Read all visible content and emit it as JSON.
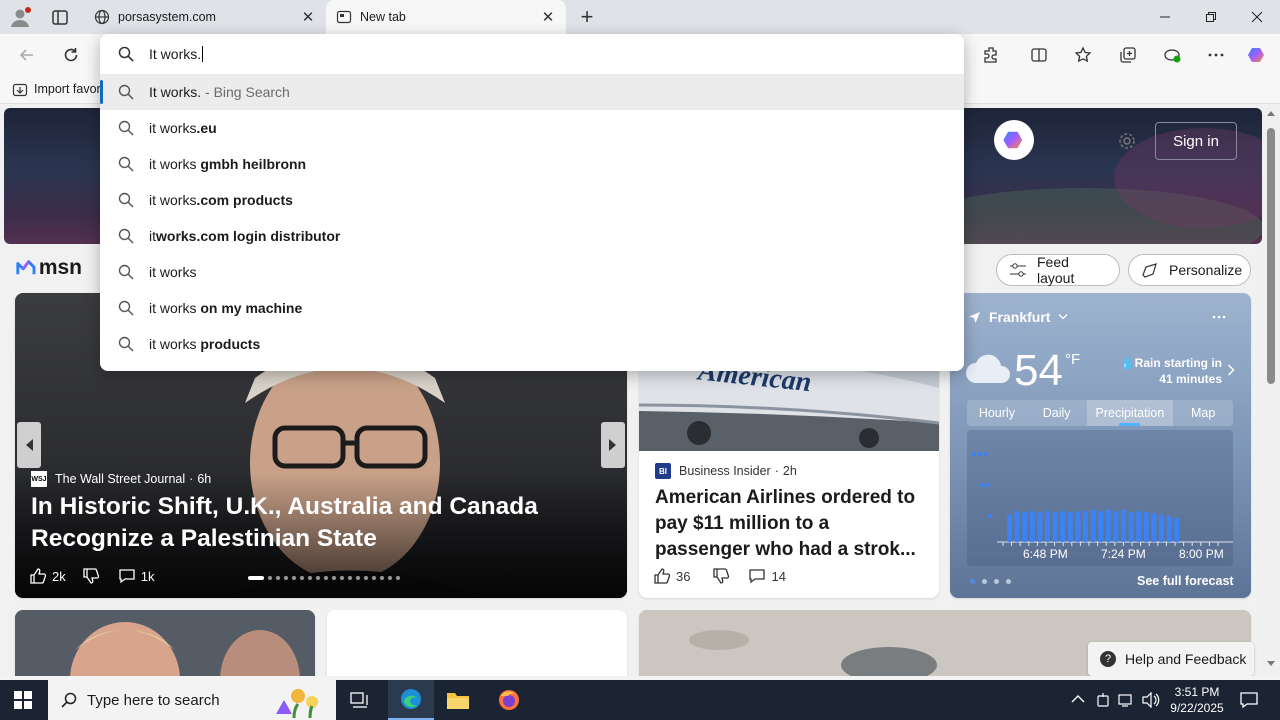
{
  "browser": {
    "tabs": [
      {
        "title": "porsasystem.com",
        "icon": "globe-icon"
      },
      {
        "title": "New tab",
        "icon": "newtab-icon"
      }
    ],
    "favorites_bar": {
      "import_label": "Import favor"
    }
  },
  "omnibox": {
    "query": "It works.",
    "suggestions": [
      {
        "prefix": "It works.",
        "bold": "",
        "suffix": " - Bing Search"
      },
      {
        "prefix": "it works",
        "bold": ".eu",
        "suffix": ""
      },
      {
        "prefix": "it works ",
        "bold": "gmbh heilbronn",
        "suffix": ""
      },
      {
        "prefix": "it works",
        "bold": ".com products",
        "suffix": ""
      },
      {
        "prefix": "it",
        "bold": "works.com login distributor",
        "suffix": ""
      },
      {
        "prefix": "it works",
        "bold": "",
        "suffix": ""
      },
      {
        "prefix": "it works ",
        "bold": "on my machine",
        "suffix": ""
      },
      {
        "prefix": "it works ",
        "bold": "products",
        "suffix": ""
      }
    ]
  },
  "msn": {
    "logo_text": "msn",
    "sign_in": "Sign in",
    "feed_layout": "Feed layout",
    "personalize": "Personalize",
    "main_story": {
      "source": "The Wall Street Journal",
      "source_badge": "WSJ",
      "age": "6h",
      "headline": "In Historic Shift, U.K., Australia and Canada Recognize a Palestinian State",
      "likes": "2k",
      "comments": "1k"
    },
    "side_story": {
      "source": "Business Insider",
      "source_badge": "BI",
      "age": "2h",
      "headline": "American Airlines ordered to pay $11 million to a passenger who had a strok...",
      "likes": "36",
      "comments": "14",
      "plane_text": "American"
    },
    "weather": {
      "location": "Frankfurt",
      "temp": "54",
      "unit": "°F",
      "alert": "Rain starting in 41 minutes",
      "tabs": [
        "Hourly",
        "Daily",
        "Precipitation",
        "Map"
      ],
      "active_tab": "Precipitation",
      "times": [
        "6:48 PM",
        "7:24 PM",
        "8:00 PM"
      ],
      "see_full": "See full forecast",
      "precip_levels": [
        0.55,
        0.62,
        0.6,
        0.62,
        0.6,
        0.62,
        0.6,
        0.62,
        0.6,
        0.62,
        0.62,
        0.65,
        0.62,
        0.65,
        0.62,
        0.65,
        0.6,
        0.62,
        0.6,
        0.58,
        0.55,
        0.52,
        0.48
      ]
    },
    "help": "Help and Feedback"
  },
  "taskbar": {
    "search_placeholder": "Type here to search",
    "time": "3:51 PM",
    "date": "9/22/2025"
  }
}
